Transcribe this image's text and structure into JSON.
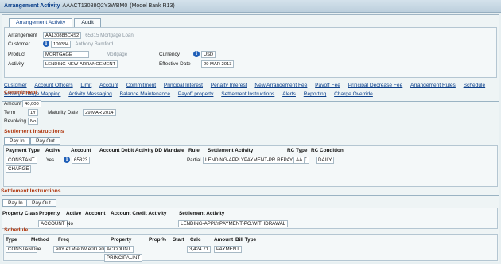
{
  "title": {
    "label": "Arrangement Activity",
    "id": "AAACT13088Q2Y3WBM0",
    "bank": "(Model Bank R13)"
  },
  "tabs": [
    {
      "label": "Arrangement Activity"
    },
    {
      "label": "Audit"
    }
  ],
  "header": {
    "arrangement_label": "Arrangement",
    "arrangement_value": "AA13088BC4S2",
    "arrangement_note": "65315 Mortgage Loan",
    "customer_label": "Customer",
    "customer_value": "100384",
    "customer_name": "Anthony Bamford",
    "product_label": "Product",
    "product_value": "MORTGAGE",
    "product_note": "Mortgage",
    "activity_label": "Activity",
    "activity_value": "LENDING-NEW-ARRANGEMENT",
    "currency_label": "Currency",
    "currency_value": "USD",
    "effective_label": "Effective Date",
    "effective_value": "29 MAR 2013"
  },
  "links": [
    "Customer",
    "Account Officers",
    "Limit",
    "Account",
    "Commitment",
    "Principal Interest",
    "Penalty Interest",
    "New Arrangement Fee",
    "Payoff Fee",
    "Principal Decrease Fee",
    "Arrangement Rules",
    "Schedule",
    "Activity Charge Mapping",
    "Activity Messaging",
    "Balance Maintenance",
    "Payoff property",
    "Settlement Instructions",
    "Alerts",
    "Reporting",
    "Charge Override"
  ],
  "commitment": {
    "title": "Commitment",
    "amount_label": "Amount",
    "amount_value": "40,000",
    "term_label": "Term",
    "term_value": "1Y",
    "maturity_label": "Maturity Date",
    "maturity_value": "29 MAR 2014",
    "revolving_label": "Revolving",
    "revolving_value": "No"
  },
  "settlement1": {
    "title": "Settlement Instructions",
    "tabs": [
      "Pay In",
      "Pay Out"
    ],
    "headers": [
      "Payment Type",
      "Active",
      "Account",
      "Account Debit Activity DD Mandate",
      "Rule",
      "Settlement Activity",
      "RC Type",
      "RC Condition"
    ],
    "row": {
      "payment_type": "CONSTANT",
      "payment_type2": "CHARGE",
      "active": "Yes",
      "account": "65323",
      "rule": "Partial",
      "activity": "LENDING-APPLYPAYMENT-PR.REPAYMENT",
      "rc_type": "AA",
      "rc_condition": "DAILY"
    }
  },
  "settlement2": {
    "title": "Settlement Instructions",
    "tabs": [
      "Pay In",
      "Pay Out"
    ],
    "headers": [
      "Property Class",
      "Property",
      "Active",
      "Account",
      "Account Credit Activity",
      "Settlement Activity"
    ],
    "row": {
      "property": "ACCOUNT",
      "active": "No",
      "activity": "LENDING-APPLYPAYMENT-PO.WITHDRAWAL"
    }
  },
  "schedule": {
    "title": "Schedule",
    "headers": [
      "Type",
      "Method",
      "Freq",
      "Property",
      "Prop %",
      "Start",
      "Calc",
      "Amount",
      "Bill Type"
    ],
    "row": {
      "type": "CONSTANT",
      "method": "Due",
      "freq": "e0Y e1M e0W e0D e0F",
      "property": "ACCOUNT",
      "property2": "PRINCIPALINT",
      "calc": "3,424.71",
      "bill_type": "PAYMENT"
    }
  }
}
